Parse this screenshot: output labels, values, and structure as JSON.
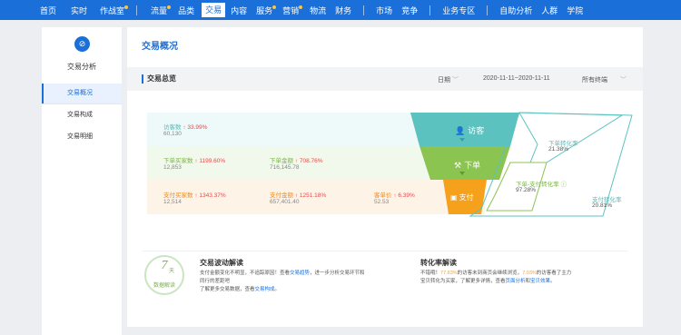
{
  "nav": {
    "items": [
      {
        "label": "首页",
        "dot": false
      },
      {
        "label": "实时",
        "dot": false
      },
      {
        "label": "作战室",
        "dot": true
      },
      {
        "label": "流量",
        "dot": true
      },
      {
        "label": "品类",
        "dot": false
      },
      {
        "label": "交易",
        "dot": false,
        "active": true
      },
      {
        "label": "内容",
        "dot": false
      },
      {
        "label": "服务",
        "dot": true
      },
      {
        "label": "营销",
        "dot": true
      },
      {
        "label": "物流",
        "dot": false
      },
      {
        "label": "财务",
        "dot": false
      },
      {
        "label": "市场",
        "dot": false
      },
      {
        "label": "竞争",
        "dot": false
      },
      {
        "label": "业务专区",
        "dot": false
      },
      {
        "label": "自助分析",
        "dot": false
      },
      {
        "label": "人群",
        "dot": false
      },
      {
        "label": "学院",
        "dot": false
      }
    ]
  },
  "sidebar": {
    "title": "交易分析",
    "icon": "trade-icon",
    "items": [
      {
        "label": "交易概况",
        "active": true
      },
      {
        "label": "交易构成",
        "active": false
      },
      {
        "label": "交易明细",
        "active": false
      }
    ]
  },
  "main": {
    "page_title": "交易概况",
    "toolbar": {
      "title": "交易总览",
      "date_label": "日期",
      "date_range": "2020-11-11~2020-11-11",
      "terminal": "所有终端"
    },
    "rows": {
      "visitors": {
        "label": "访客数",
        "change": "33.99%",
        "value": "60,130"
      },
      "order_buyers": {
        "label": "下单买家数",
        "change": "1199.60%",
        "value": "12,853"
      },
      "order_amount": {
        "label": "下单金额",
        "change": "708.76%",
        "value": "716,145.78"
      },
      "pay_buyers": {
        "label": "支付买家数",
        "change": "1343.37%",
        "value": "12,514"
      },
      "pay_amount": {
        "label": "支付金额",
        "change": "1251.18%",
        "value": "657,401.40"
      },
      "unit_price": {
        "label": "客单价",
        "change": "6.39%",
        "value": "52.53"
      }
    },
    "funnel": {
      "visit": "访客",
      "order": "下单",
      "pay": "支付"
    },
    "conversion": {
      "order_rate_label": "下单转化率",
      "order_rate": "21.38%",
      "order_pay_label": "下单-支付转化率",
      "order_pay_rate": "97.28%",
      "pay_rate_label": "支付转化率",
      "pay_rate": "20.81%"
    },
    "insight": {
      "days_num": "7",
      "days_unit": "天",
      "days_caption": "数据解读",
      "fluct_title": "交易波动解读",
      "fluct_line1_pre": "支付金额变化不明显，不追踪原因！查看",
      "fluct_line1_link": "交易趋势",
      "fluct_line1_post": "，进一步分析交易环节和",
      "fluct_line2": "同行的差距吧",
      "fluct_line3_pre": "了解更多交易数据，查看",
      "fluct_line3_link": "交易构成",
      "fluct_line3_post": "。",
      "conv_title": "转化率解读",
      "conv_line1_pre": "不错哦！",
      "conv_line1_p1": "77.83%",
      "conv_line1_mid": "的访客未到商页会继续浏览，",
      "conv_line1_p2": "7.03%",
      "conv_line1_post": "的访客看了主力",
      "conv_line2_pre": "宝贝转化为买家，了解更多详情，查看",
      "conv_line2_link1": "页面分析",
      "conv_line2_mid": "和",
      "conv_line2_link2": "宝贝效果",
      "conv_line2_post": "。"
    }
  },
  "colors": {
    "brand": "#1b6fd8",
    "teal": "#5cb8b7",
    "green": "#7ab448",
    "orange": "#f08a1c",
    "up": "#e64b4b"
  }
}
